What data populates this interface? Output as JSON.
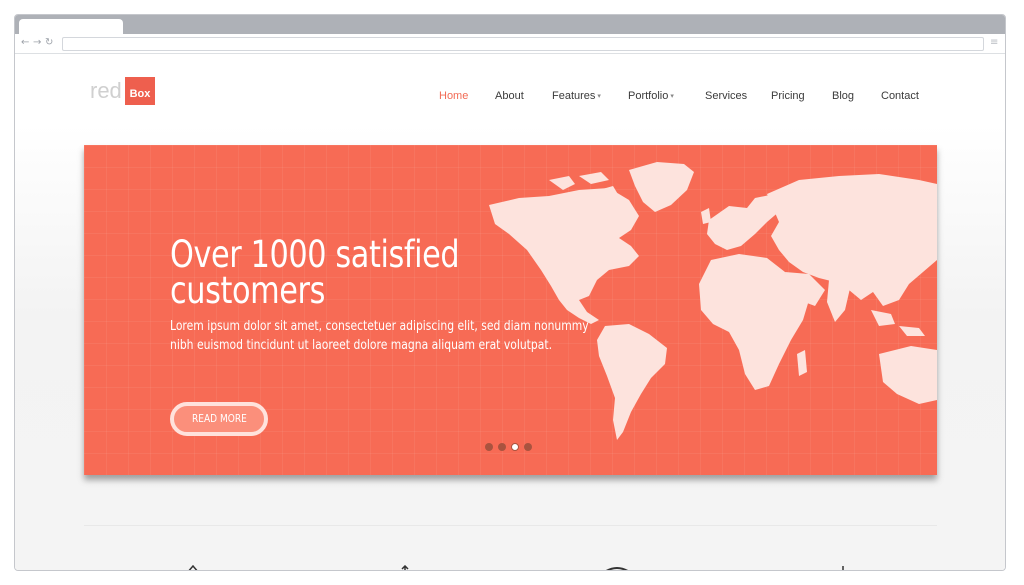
{
  "brand": {
    "logo_text": "red",
    "logo_badge": "Box",
    "accent": "#f76b55"
  },
  "nav": {
    "items": [
      {
        "label": "Home",
        "active": true
      },
      {
        "label": "About"
      },
      {
        "label": "Features",
        "dropdown": true
      },
      {
        "label": "Portfolio",
        "dropdown": true
      },
      {
        "label": "Services"
      },
      {
        "label": "Pricing"
      },
      {
        "label": "Blog"
      },
      {
        "label": "Contact"
      }
    ]
  },
  "hero": {
    "headline_line1": "Over 1000 satisfied",
    "headline_line2": "customers",
    "body": "Lorem ipsum dolor sit amet, consectetuer adipiscing elit, sed diam nonummy nibh euismod tincidunt ut laoreet dolore magna aliquam erat volutpat.",
    "button_label": "READ MORE",
    "slide_count": 4,
    "active_slide": 3
  },
  "icons": {
    "back": "←",
    "forward": "→",
    "reload": "↻",
    "menu": "≡",
    "caret": "▾"
  }
}
